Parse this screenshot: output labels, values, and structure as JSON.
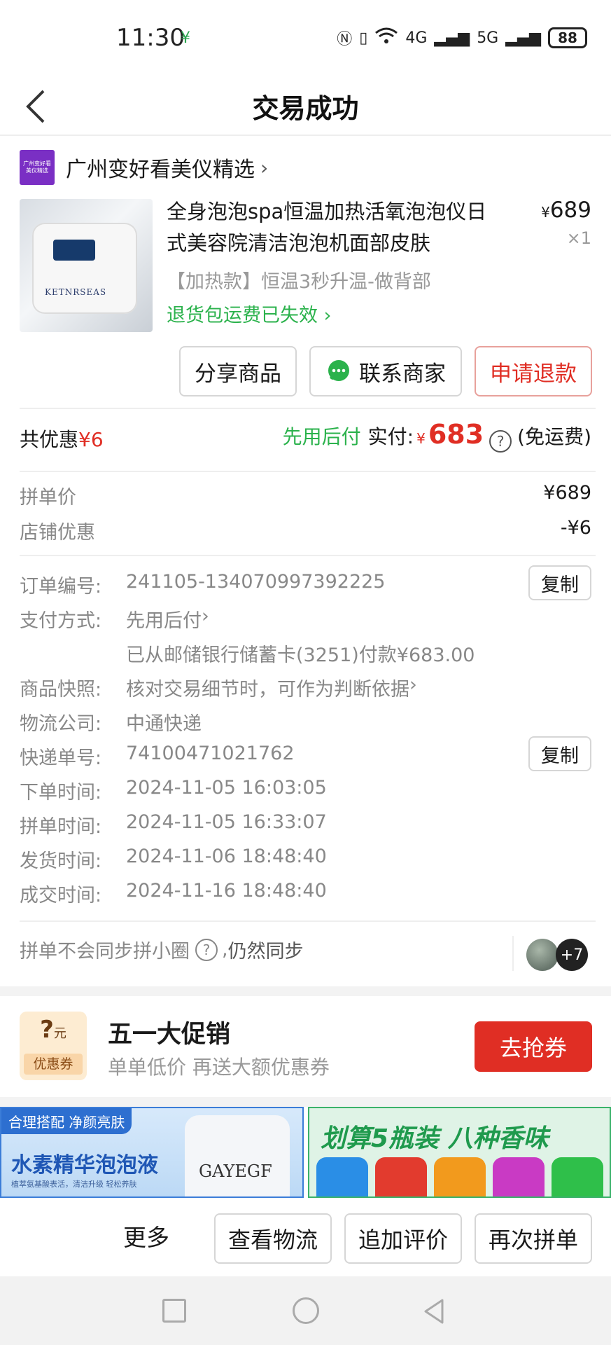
{
  "status_bar": {
    "time": "11:30",
    "network_1": "4G",
    "network_2": "5G",
    "battery": "88"
  },
  "header": {
    "title": "交易成功"
  },
  "shop": {
    "logo_text": "广州变好看美仪精选",
    "name": "广州变好看美仪精选"
  },
  "product": {
    "title": "全身泡泡spa恒温加热活氧泡泡仪日式美容院清洁泡泡机面部皮肤",
    "image_brand": "KETNRSEAS",
    "price_symbol": "¥",
    "price": "689",
    "quantity": "×1",
    "spec": "【加热款】恒温3秒升温-做背部",
    "return_note": "退货包运费已失效"
  },
  "actions": {
    "share": "分享商品",
    "contact": "联系商家",
    "refund": "申请退款"
  },
  "totals": {
    "discount_label": "共优惠",
    "discount_value": "¥6",
    "pay_later": "先用后付",
    "paid_label": "实付:",
    "paid_symbol": "¥",
    "paid_amount": "683",
    "help": "?",
    "shipping": "(免运费)"
  },
  "price_breakdown": [
    {
      "label": "拼单价",
      "value": "¥689"
    },
    {
      "label": "店铺优惠",
      "value": "-¥6"
    }
  ],
  "order_info": {
    "order_no_label": "订单编号:",
    "order_no": "241105-134070997392225",
    "copy": "复制",
    "payment_label": "支付方式:",
    "payment_method": "先用后付",
    "payment_detail": "已从邮储银行储蓄卡(3251)付款¥683.00",
    "snapshot_label": "商品快照:",
    "snapshot_text": "核对交易细节时，可作为判断依据",
    "logistics_label": "物流公司:",
    "logistics_company": "中通快递",
    "tracking_label": "快递单号:",
    "tracking_no": "74100471021762",
    "order_time_label": "下单时间:",
    "order_time": "2024-11-05 16:03:05",
    "group_time_label": "拼单时间:",
    "group_time": "2024-11-05 16:33:07",
    "ship_time_label": "发货时间:",
    "ship_time": "2024-11-06 18:48:40",
    "deal_time_label": "成交时间:",
    "deal_time": "2024-11-16 18:48:40"
  },
  "sync": {
    "text": "拼单不会同步拼小圈",
    "help": "?",
    "comma": ",",
    "action": "仍然同步",
    "extra_count": "+7"
  },
  "promo": {
    "coupon_symbol": "?",
    "coupon_unit": "元",
    "coupon_label": "优惠券",
    "title": "五一大促销",
    "subtitle": "单单低价 再送大额优惠券",
    "button": "去抢券"
  },
  "ads": {
    "left_tag": "合理搭配 净颜亮肤",
    "left_headline": "水素精华泡泡液",
    "left_small": "植萃氨基酸表活，清洁升级 轻松养肤",
    "left_brand": "GAYEGF",
    "right_headline": "划算5瓶装 八种香味",
    "right_bottle_colors": [
      "#2a8ee6",
      "#e23b2e",
      "#f29a1d",
      "#c93ac4",
      "#2fbf4a"
    ]
  },
  "bottom_bar": {
    "more": "更多",
    "logistics": "查看物流",
    "review": "追加评价",
    "reorder": "再次拼单"
  },
  "colors": {
    "accent_red": "#e02e24",
    "accent_green": "#2bb24c"
  }
}
